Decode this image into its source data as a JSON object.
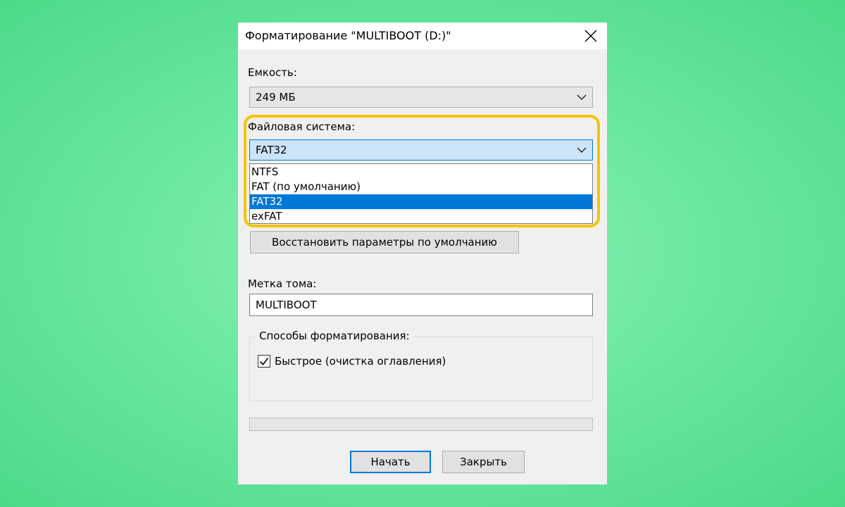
{
  "dialog": {
    "title": "Форматирование \"MULTIBOOT (D:)\"",
    "capacity": {
      "label": "Емкость:",
      "value": "249 МБ"
    },
    "filesystem": {
      "label": "Файловая система:",
      "value": "FAT32",
      "options": [
        "NTFS",
        "FAT (по умолчанию)",
        "FAT32",
        "exFAT"
      ],
      "selected_index": 2
    },
    "restore_defaults_label": "Восстановить параметры по умолчанию",
    "volume_label": {
      "label": "Метка тома:",
      "value": "MULTIBOOT"
    },
    "format_options": {
      "legend": "Способы форматирования:",
      "quick_label": "Быстрое (очистка оглавления)",
      "quick_checked": true
    },
    "progress": 0,
    "start_label": "Начать",
    "close_label": "Закрыть"
  },
  "colors": {
    "accent": "#0078d7",
    "highlight_frame": "#f5c400",
    "background": "#6ce8a2"
  }
}
